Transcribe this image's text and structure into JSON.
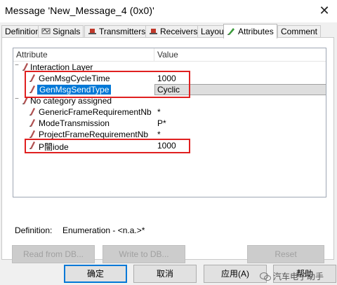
{
  "window": {
    "title": "Message 'New_Message_4 (0x0)'",
    "close_glyph": "✕"
  },
  "tabs": [
    {
      "label": "Definition",
      "icon": "none"
    },
    {
      "label": "Signals",
      "icon": "signals-icon"
    },
    {
      "label": "Transmitters",
      "icon": "node-icon"
    },
    {
      "label": "Receivers",
      "icon": "node-icon"
    },
    {
      "label": "Layout",
      "icon": "none"
    },
    {
      "label": "Attributes",
      "icon": "pencil-icon"
    },
    {
      "label": "Comment",
      "icon": "none"
    }
  ],
  "tree": {
    "columns": [
      "Attribute",
      "Value"
    ],
    "groups": [
      {
        "label": "Interaction Layer",
        "rows": [
          {
            "name": "GenMsgCycleTime",
            "value": "1000"
          },
          {
            "name": "GenMsgSendType",
            "value": "Cyclic",
            "selected": true
          }
        ]
      },
      {
        "label": "No category assigned",
        "rows": [
          {
            "name": "GenericFrameRequirementNb",
            "value": "*"
          },
          {
            "name": "ModeTransmission",
            "value": "P*"
          },
          {
            "name": "ProjectFrameRequirementNb",
            "value": "*"
          },
          {
            "name": "P闓iode",
            "value": "1000"
          }
        ]
      }
    ],
    "expander": "−"
  },
  "definition": {
    "label": "Definition:",
    "value": "Enumeration - <n.a.>*"
  },
  "buttons": {
    "read_from_db": "Read from DB...",
    "write_to_db": "Write to DB...",
    "reset": "Reset",
    "ok": "确定",
    "cancel": "取消",
    "apply": "应用(A)",
    "help": "帮助"
  },
  "watermark": {
    "text": "汽车电子助手"
  },
  "colors": {
    "selection": "#0078d7",
    "highlight_box": "#e02020"
  }
}
